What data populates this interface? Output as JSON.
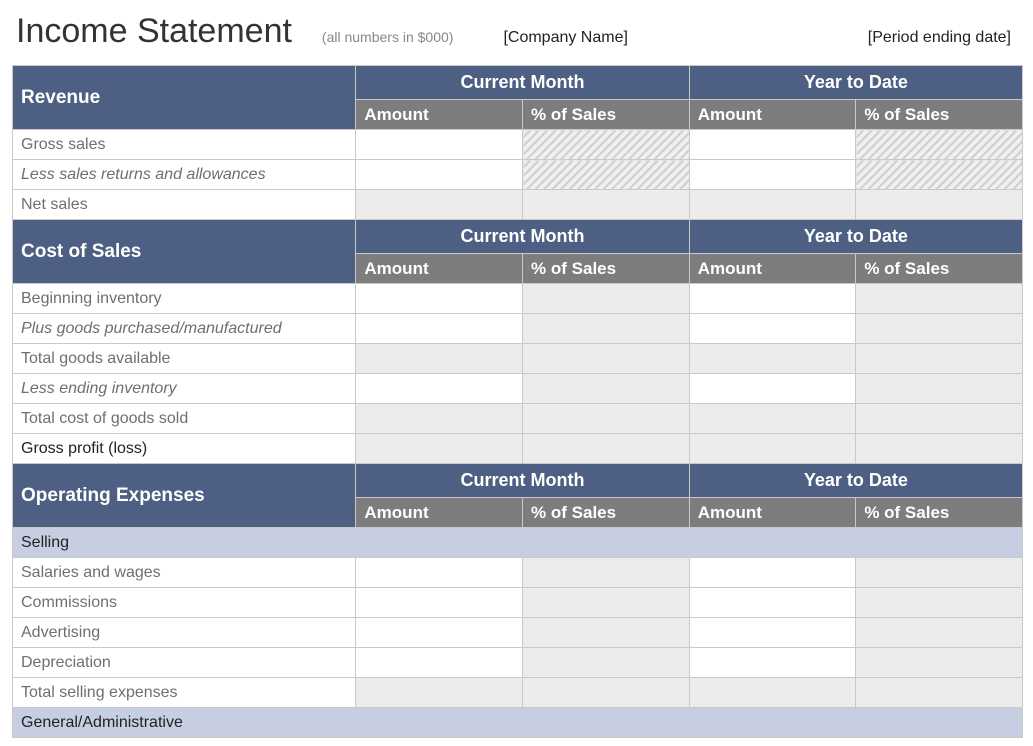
{
  "header": {
    "title": "Income Statement",
    "subtitle": "(all numbers in $000)",
    "company": "[Company Name]",
    "period": "[Period ending date]"
  },
  "columns": {
    "cm": "Current Month",
    "ytd": "Year to Date",
    "amount": "Amount",
    "pct": "% of Sales"
  },
  "sections": {
    "revenue": {
      "title": "Revenue",
      "rows": {
        "gross_sales": "Gross sales",
        "less_returns": "Less sales returns and allowances",
        "net_sales": "Net sales"
      }
    },
    "cost_of_sales": {
      "title": "Cost of Sales",
      "rows": {
        "beginning_inventory": "Beginning inventory",
        "plus_goods": "Plus goods purchased/manufactured",
        "total_goods": "Total goods available",
        "less_ending": "Less ending inventory",
        "total_cogs": "Total cost of goods sold",
        "gross_profit": "Gross profit (loss)"
      }
    },
    "operating_expenses": {
      "title": "Operating Expenses",
      "subsections": {
        "selling": {
          "title": "Selling",
          "rows": {
            "salaries": "Salaries and wages",
            "commissions": "Commissions",
            "advertising": "Advertising",
            "depreciation": "Depreciation",
            "total_selling": "Total selling expenses"
          }
        },
        "general_admin": {
          "title": "General/Administrative"
        }
      }
    }
  }
}
